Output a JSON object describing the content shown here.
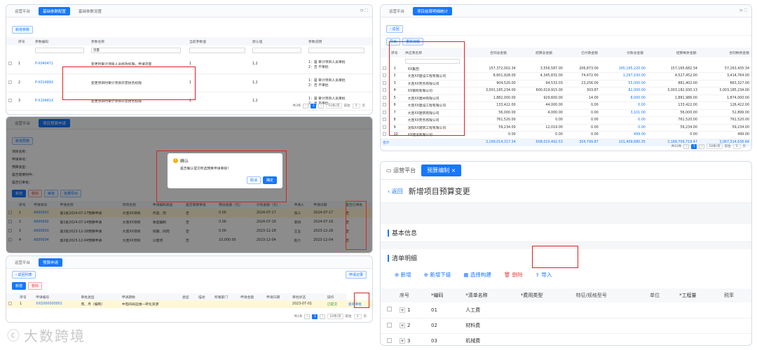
{
  "p1": {
    "tabs": [
      "运营平台",
      "基础参数配置",
      "基础参数设置"
    ],
    "add_btn": "新增参数",
    "cols": [
      "",
      "序号",
      "参数编码",
      "参数名称",
      "当前参数值",
      "默认值",
      "参数说明"
    ],
    "filter": "流量",
    "rows": [
      {
        "i": "1",
        "code": "P-X040472",
        "name": "变更时审计项目人员修改权限，申请流量",
        "cur": "1",
        "def": "1,2",
        "desc": [
          "1：是 审计项目人员审批",
          "2：否 不审批"
        ]
      },
      {
        "i": "2",
        "code": "P-X01489X",
        "name": "变更项目时审计项目开票财务权限",
        "cur": "1",
        "def": "1,2",
        "desc": [
          "1：是 审计项目人员审批",
          "2：否 不审批"
        ]
      },
      {
        "i": "3",
        "code": "P-X10481X",
        "name": "变更项目时审计项目开票财务权限",
        "cur": "1",
        "def": "1,2",
        "desc": [
          "1：是 审计项目人员审批",
          "2：否 不审批"
        ]
      }
    ],
    "pager": [
      "共3条",
      "1",
      "10条/页",
      "前往",
      "1",
      "页"
    ]
  },
  "p2": {
    "tabs": [
      "运营平台",
      "项目结算明细统计"
    ],
    "back": "返回",
    "btns": [
      "导出",
      "重新加载"
    ],
    "cols": [
      "",
      "序号",
      "供应商名称",
      "合同总金额",
      "结算总金额",
      "已付款金额",
      "付款总金额",
      "结算剩余金额",
      "合同剩余金额"
    ],
    "rows": [
      [
        "1",
        "XX集团",
        "157,372,002.34",
        "3,556,587.00",
        "206,873.00",
        "165,195,220.00",
        "157,165,682.34",
        "57,263,435.34"
      ],
      [
        "2",
        "大连XX建设工程有限公司",
        "8,601,928.00",
        "4,345,831.00",
        "74,472.00",
        "1,297,100.00",
        "4,527,452.00",
        "3,414,764.00"
      ],
      [
        "3",
        "大连XX劳务有限公司",
        "904,520.00",
        "94,533.03",
        "23,256.00",
        "55,000.00",
        "881,402.00",
        "863,327.00"
      ],
      [
        "4",
        "XX钢构有限公司",
        "3,001,185,234.00",
        "600,019,915.00",
        "303.87",
        "82,000.00",
        "3,003,182,930.13",
        "3,003,185,234.00"
      ],
      [
        "5",
        "大连XX建材有限公司",
        "1,882,000.00",
        "929,600.00",
        "14.00",
        "8,000.00",
        "1,881,986.00",
        "1,874,000.00"
      ],
      [
        "6",
        "大连XX建设工程有限公司",
        "133,422.00",
        "44,000.00",
        "0.00",
        "0.00",
        "133,422.00",
        "126,422.00"
      ],
      [
        "7",
        "大连XX建筑有限公司",
        "56,000.00",
        "4,000.00",
        "0.00",
        "3,101.00",
        "56,000.00",
        "52,899.00"
      ],
      [
        "8",
        "大连XX劳务有限公司",
        "761,520.00",
        "0.00",
        "0.00",
        "0.00",
        "761,520.00",
        "761,520.00"
      ],
      [
        "9",
        "沈阳XX建筑工程有限公司",
        "59,234.00",
        "12,019.00",
        "0.00",
        "0.00",
        "59,234.00",
        "59,234.00"
      ],
      [
        "10",
        "XX建设有限公司",
        "0.00",
        "0.00",
        "0.00",
        "499.00",
        "0.00",
        "499.00"
      ]
    ],
    "total": [
      "合计",
      "3,169,014,317.34",
      "608,010,492.53",
      "304,799.87",
      "101,409,680.35",
      "3,168,709,718.47",
      "3,067,314,636.84"
    ],
    "pager": [
      "共10条",
      "1",
      "10条/页",
      "前往",
      "1",
      "页"
    ]
  },
  "p3": {
    "tabs": [
      "运营平台",
      "项目预算申请"
    ],
    "btn": "新增预算",
    "form_labels": [
      "项目名称：",
      "申请单号：",
      "预算类型：",
      "是否需要附件：",
      "是否已审批："
    ],
    "actions": [
      "新增",
      "删除",
      "审批",
      "批量导出"
    ],
    "cols": [
      "",
      "序号",
      "申请单号",
      "申请名称",
      "项目名称",
      "申请编制类型",
      "是否需要审批",
      "预估金额（元）",
      "计划金额（元）",
      "申请人",
      "申请日期",
      "是否已审批"
    ],
    "rows": [
      [
        "1",
        "A000001",
        "第1批2024-07-17预算申请",
        "大连XX项目",
        "月度、周",
        "否",
        "0.00",
        "2024-07-17",
        "张三",
        "2024-07-17",
        "否"
      ],
      [
        "2",
        "A000002",
        "第1批2024-07-14预算申请",
        "大连XX项目",
        "季度编制",
        "否",
        "0.00",
        "2024-07-18",
        "李四",
        "2024-07-18",
        "否"
      ],
      [
        "3",
        "A000003",
        "第2批2023-12-28预算申请",
        "大连XX项目",
        "同期、同周",
        "否",
        "0.00",
        "2023-12-28",
        "王五",
        "2023-12-28",
        "否"
      ],
      [
        "4",
        "A000004",
        "第2批2023-12-04预算申请",
        "大连XX项目",
        "公建项",
        "否",
        "10,000.00",
        "2023-12-04",
        "赵六",
        "2023-12-04",
        "否"
      ]
    ],
    "dialog": {
      "title": "确认",
      "msg": "是否确认提交所选预算申请审核？",
      "cancel": "取消",
      "ok": "确定"
    }
  },
  "p4": {
    "tabs": [
      "运营平台",
      "预算申请"
    ],
    "back": "返回列表",
    "btns": [
      "新增",
      "删除"
    ],
    "right_btn": "申请记录",
    "cols": [
      "",
      "序号",
      "申请编号",
      "审批类型",
      "申请期数",
      "类型",
      "描述",
      "所属部门",
      "申请金额",
      "申请日期",
      "审批状态",
      "操作"
    ],
    "row": [
      "1",
      "XXQ000000001",
      "周、月（编制）",
      "中电四局运维—转化资源",
      "",
      "",
      "",
      "",
      "",
      "2023-07-01",
      "已提交",
      "查询审批"
    ],
    "pager": [
      "共1条",
      "1",
      "10条/页",
      "前往",
      "1",
      "页"
    ]
  },
  "p5": {
    "tabs": [
      "运营平台",
      "预算编制"
    ],
    "back": "返回",
    "title": "新增项目预算变更",
    "section1": "基本信息",
    "section2": "清单明细",
    "tools": [
      "新增",
      "新增下级",
      "选择构建",
      "删除",
      "导入"
    ],
    "cols": [
      "",
      "序号",
      "*编码",
      "*清单名称",
      "*费用类型",
      "特征/规格型号",
      "单位",
      "*工程量",
      "税率"
    ],
    "rows": [
      [
        "1",
        "01",
        "人工费"
      ],
      [
        "2",
        "02",
        "材料费"
      ],
      [
        "3",
        "03",
        "机械费"
      ]
    ]
  },
  "watermark": "大数跨境",
  "accent": "#1677ff",
  "alert": "#e02020"
}
